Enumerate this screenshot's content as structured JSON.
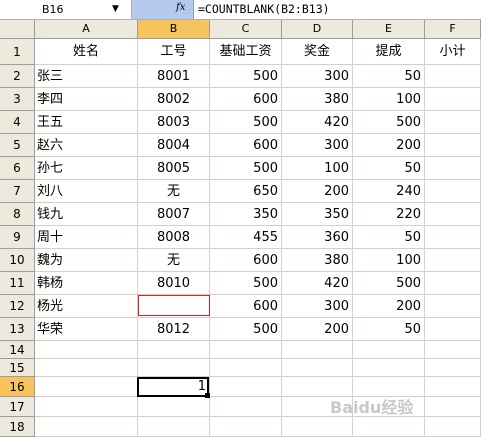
{
  "formula_bar": {
    "name_box": "B16",
    "fx_label": "fx",
    "formula": "=COUNTBLANK(B2:B13)"
  },
  "columns": [
    "A",
    "B",
    "C",
    "D",
    "E",
    "F"
  ],
  "active_column": "B",
  "active_row": "16",
  "rows": [
    {
      "num": "1",
      "cells": [
        "姓名",
        "工号",
        "基础工资",
        "奖金",
        "提成",
        "小计"
      ]
    },
    {
      "num": "2",
      "cells": [
        "张三",
        "8001",
        "500",
        "300",
        "50",
        ""
      ]
    },
    {
      "num": "3",
      "cells": [
        "李四",
        "8002",
        "600",
        "380",
        "100",
        ""
      ]
    },
    {
      "num": "4",
      "cells": [
        "王五",
        "8003",
        "500",
        "420",
        "500",
        ""
      ]
    },
    {
      "num": "5",
      "cells": [
        "赵六",
        "8004",
        "600",
        "300",
        "200",
        ""
      ]
    },
    {
      "num": "6",
      "cells": [
        "孙七",
        "8005",
        "500",
        "100",
        "50",
        ""
      ]
    },
    {
      "num": "7",
      "cells": [
        "刘八",
        "无",
        "650",
        "200",
        "240",
        ""
      ]
    },
    {
      "num": "8",
      "cells": [
        "钱九",
        "8007",
        "350",
        "350",
        "220",
        ""
      ]
    },
    {
      "num": "9",
      "cells": [
        "周十",
        "8008",
        "455",
        "360",
        "50",
        ""
      ]
    },
    {
      "num": "10",
      "cells": [
        "魏为",
        "无",
        "600",
        "380",
        "100",
        ""
      ]
    },
    {
      "num": "11",
      "cells": [
        "韩杨",
        "8010",
        "500",
        "420",
        "500",
        ""
      ]
    },
    {
      "num": "12",
      "cells": [
        "杨光",
        "",
        "600",
        "300",
        "200",
        ""
      ]
    },
    {
      "num": "13",
      "cells": [
        "华荣",
        "8012",
        "500",
        "200",
        "50",
        ""
      ]
    },
    {
      "num": "14",
      "cells": [
        "",
        "",
        "",
        "",
        "",
        ""
      ]
    },
    {
      "num": "15",
      "cells": [
        "",
        "",
        "",
        "",
        "",
        ""
      ]
    },
    {
      "num": "16",
      "cells": [
        "",
        "1",
        "",
        "",
        "",
        ""
      ]
    },
    {
      "num": "17",
      "cells": [
        "",
        "",
        "",
        "",
        "",
        ""
      ]
    },
    {
      "num": "18",
      "cells": [
        "",
        "",
        "",
        "",
        "",
        ""
      ]
    }
  ],
  "watermark": "Baidu经验"
}
